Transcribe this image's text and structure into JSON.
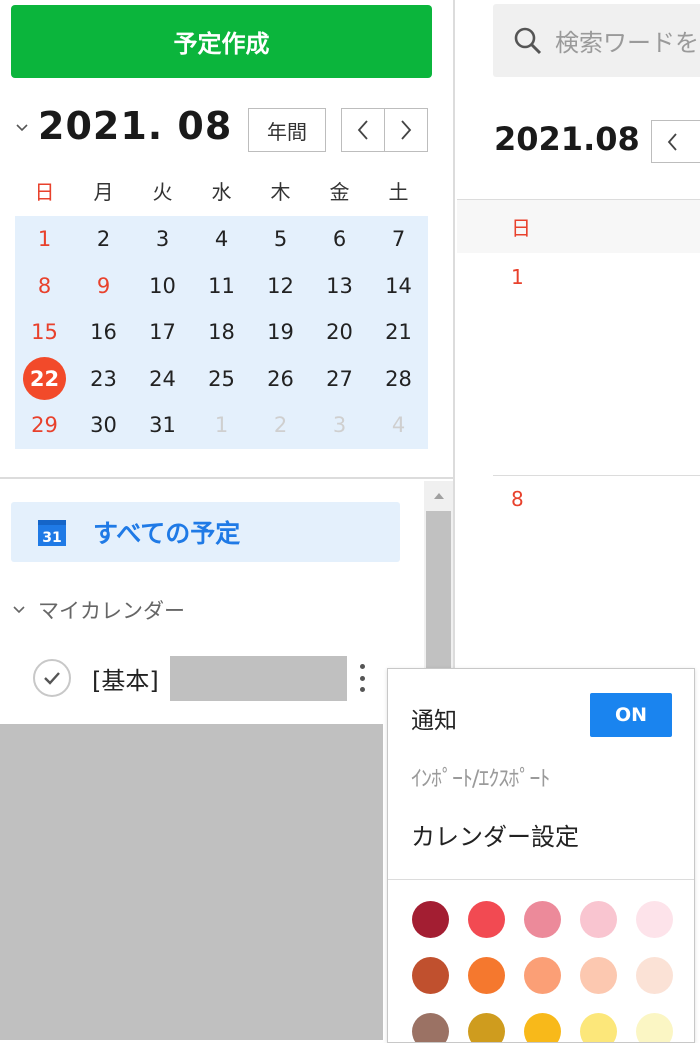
{
  "left": {
    "create_button": "予定作成",
    "month_title": "2021. 08",
    "year_button": "年間",
    "weekdays": [
      "日",
      "月",
      "火",
      "水",
      "木",
      "金",
      "土"
    ],
    "weeks": [
      [
        "1",
        "2",
        "3",
        "4",
        "5",
        "6",
        "7"
      ],
      [
        "8",
        "9",
        "10",
        "11",
        "12",
        "13",
        "14"
      ],
      [
        "15",
        "16",
        "17",
        "18",
        "19",
        "20",
        "21"
      ],
      [
        "22",
        "23",
        "24",
        "25",
        "26",
        "27",
        "28"
      ],
      [
        "29",
        "30",
        "31",
        "1",
        "2",
        "3",
        "4"
      ]
    ],
    "today": "22",
    "all_events_icon_number": "31",
    "all_events_label": "すべての予定",
    "my_calendars_label": "マイカレンダー",
    "calendar_item_name": "[基本]"
  },
  "main": {
    "search_placeholder": "検索ワードを",
    "month_title": "2021.08",
    "column_header": "日",
    "day_1": "1",
    "day_8": "8"
  },
  "popup": {
    "notify_label": "通知",
    "notify_toggle": "ON",
    "import_export": "ｲﾝﾎﾟｰﾄ/ｴｸｽﾎﾟｰﾄ",
    "settings": "カレンダー設定",
    "swatch_rows": [
      [
        "#a31e32",
        "#f24a52",
        "#ec8a9a",
        "#f9c5d0",
        "#fde3ea"
      ],
      [
        "#c0502e",
        "#f5782e",
        "#fb9f76",
        "#fcc8b0",
        "#fbe2d6"
      ],
      [
        "#9b7264",
        "#cf9c1e",
        "#f8b91a",
        "#fce77a",
        "#fbf6c4"
      ]
    ]
  },
  "colors": {
    "brand_green": "#0bb53c",
    "accent_blue": "#1a84ef",
    "today_red": "#f24a2a",
    "sunday_red": "#e8412c",
    "selected_bg": "#e4f0fc"
  }
}
